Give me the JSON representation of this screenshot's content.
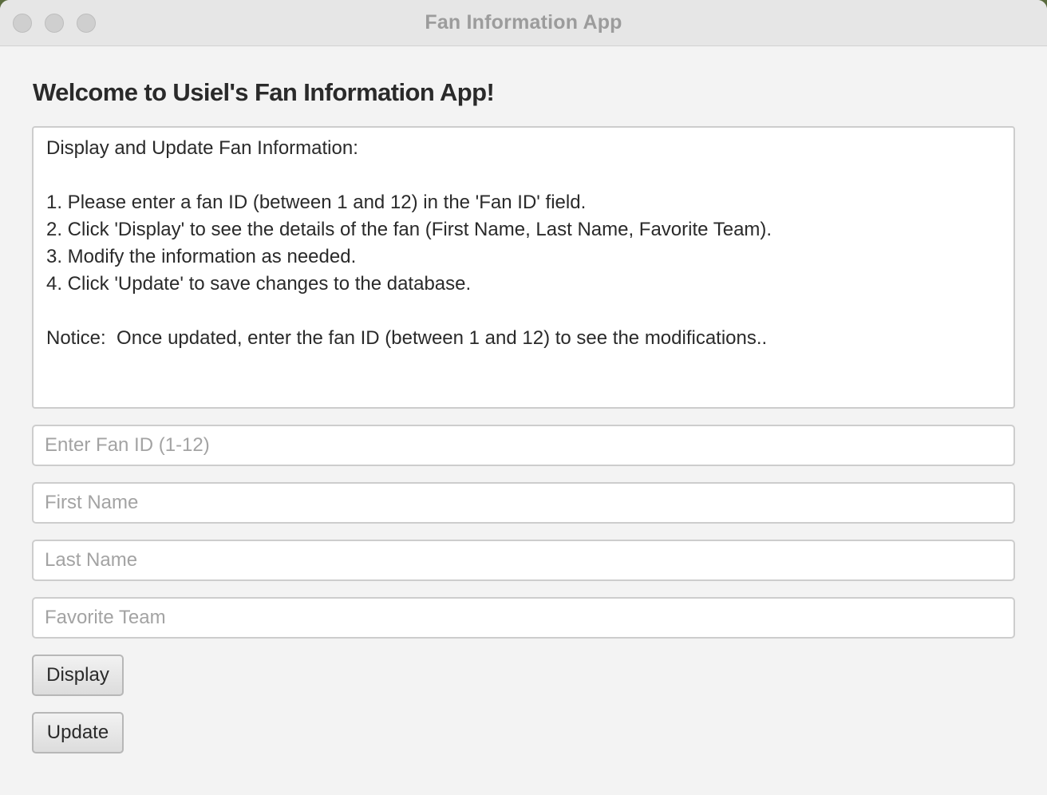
{
  "window": {
    "title": "Fan Information App"
  },
  "main": {
    "heading": "Welcome to Usiel's Fan Information App!",
    "instructions": "Display and Update Fan Information:\n\n1. Please enter a fan ID (between 1 and 12) in the 'Fan ID' field.\n2. Click 'Display' to see the details of the fan (First Name, Last Name, Favorite Team).\n3. Modify the information as needed.\n4. Click 'Update' to save changes to the database.\n\nNotice:  Once updated, enter the fan ID (between 1 and 12) to see the modifications.."
  },
  "form": {
    "fan_id_placeholder": "Enter Fan ID (1-12)",
    "first_name_placeholder": "First Name",
    "last_name_placeholder": "Last Name",
    "favorite_team_placeholder": "Favorite Team",
    "display_label": "Display",
    "update_label": "Update"
  }
}
